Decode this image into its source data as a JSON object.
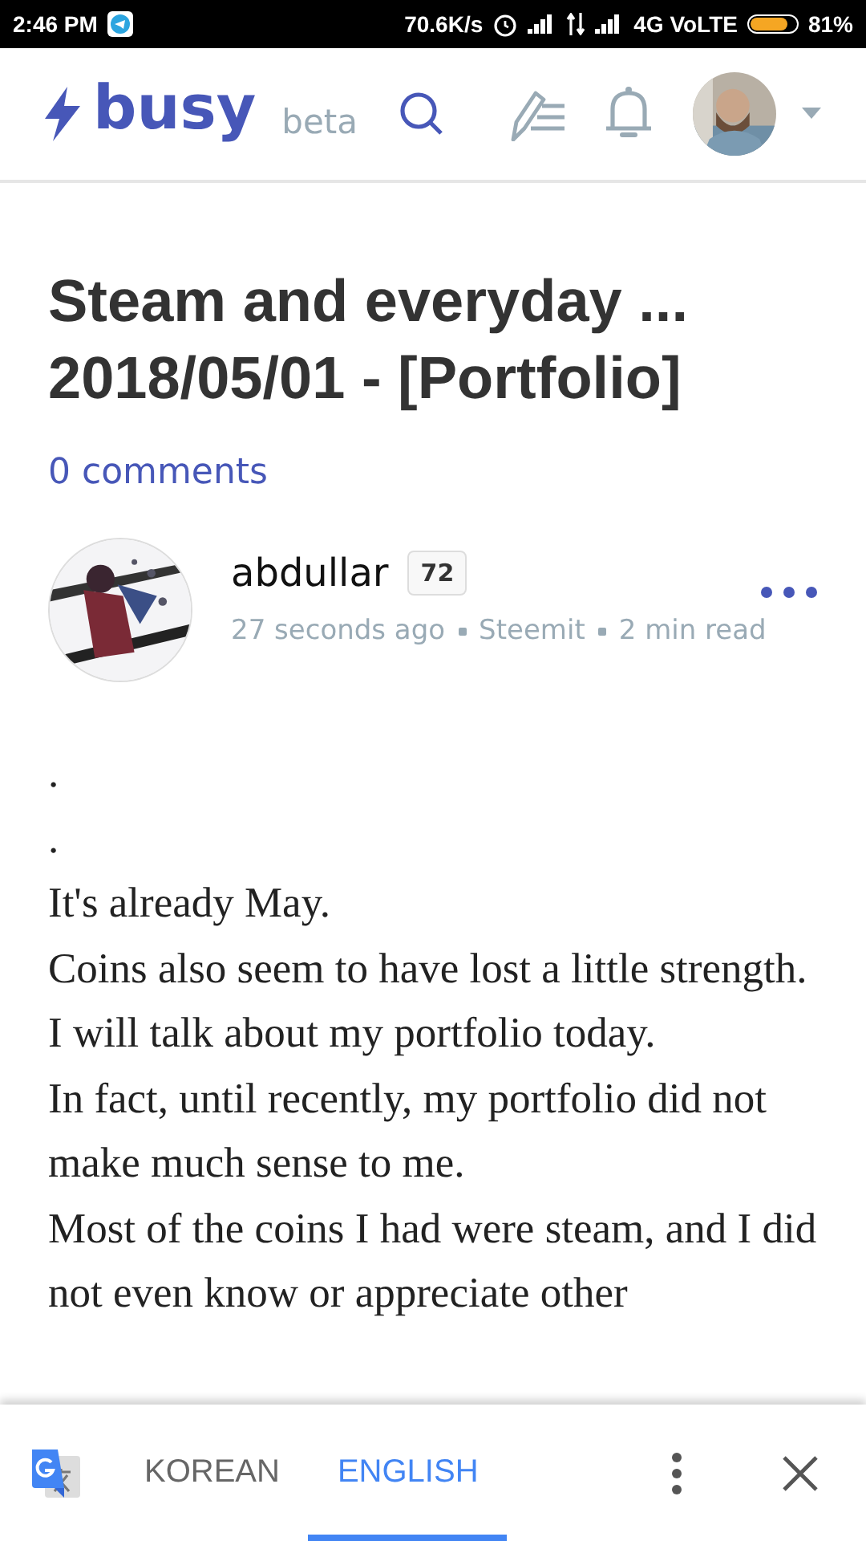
{
  "status_bar": {
    "time": "2:46 PM",
    "speed": "70.6K/s",
    "network": "4G VoLTE",
    "battery": "81%"
  },
  "header": {
    "logo": "busy",
    "tag": "beta"
  },
  "post": {
    "title": "Steam and everyday ... 2018/05/01 - [Portfolio]",
    "comments": "0 comments",
    "author": {
      "name": "abdullar",
      "reputation": "72",
      "time": "27 seconds ago",
      "app": "Steemit",
      "read_time": "2 min read"
    },
    "paragraphs": [
      ".",
      ".",
      "It's already May.",
      "Coins also seem to have lost a little strength.",
      "I will talk about my portfolio today.",
      "In fact, until recently, my portfolio did not make much sense to me.",
      "Most of the coins I had were steam, and I did not even know or appreciate other"
    ]
  },
  "translate_bar": {
    "tabs": [
      {
        "label": "KOREAN",
        "selected": false
      },
      {
        "label": "ENGLISH",
        "selected": true
      }
    ]
  }
}
